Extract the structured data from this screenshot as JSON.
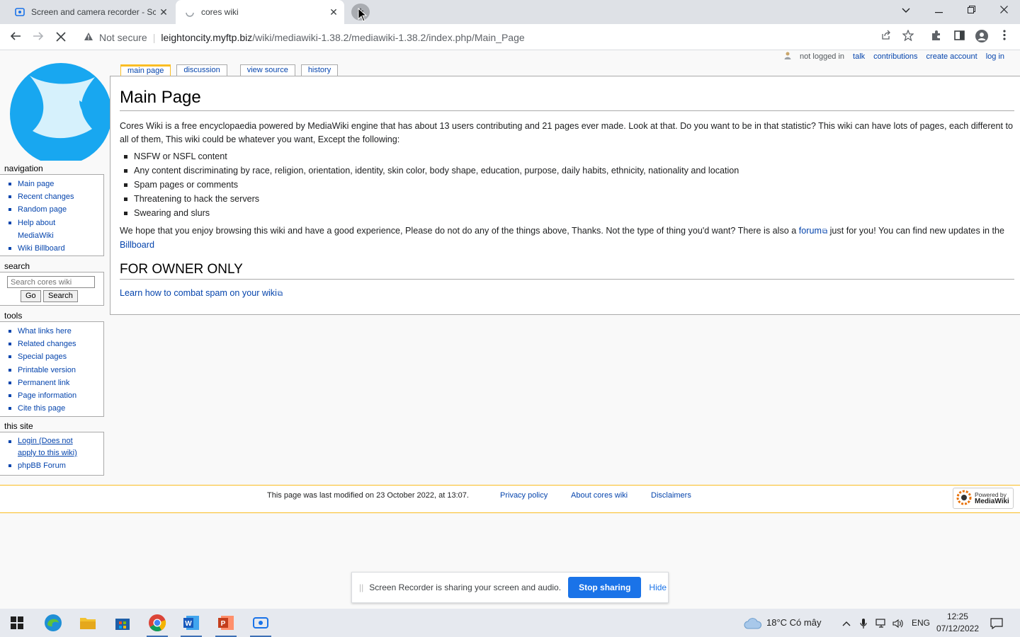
{
  "browser": {
    "tabs": [
      {
        "title": "Screen and camera recorder - Sc",
        "close": "✕"
      },
      {
        "title": "cores wiki",
        "close": "✕"
      }
    ],
    "new_tab": "+",
    "address": {
      "security_label": "Not secure",
      "host": "leightoncity.myftp.biz",
      "path": "/wiki/mediawiki-1.38.2/mediawiki-1.38.2/index.php/Main_Page"
    }
  },
  "personal": {
    "not_logged_in": "not logged in",
    "talk": "talk",
    "contributions": "contributions",
    "create_account": "create account",
    "log_in": "log in"
  },
  "page_tabs": [
    "main page",
    "discussion",
    "view source",
    "history"
  ],
  "content": {
    "title": "Main Page",
    "intro": "Cores Wiki is a free encyclopaedia powered by MediaWiki engine that has about 13 users contributing and 21 pages ever made. Look at that. Do you want to be in that statistic? This wiki can have lots of pages, each different to all of them, This wiki could be whatever you want, Except the following:",
    "rules": [
      "NSFW or NSFL content",
      "Any content discriminating by race, religion, orientation, identity, skin color, body shape, education, purpose, daily habits, ethnicity, nationality and location",
      "Spam pages or comments",
      "Threatening to hack the servers",
      "Swearing and slurs"
    ],
    "outro_before": "We hope that you enjoy browsing this wiki and have a good experience, Please do not do any of the things above, Thanks. Not the type of thing you'd want? There is also a",
    "forum_link": "forum",
    "outro_middle": "just for you! You can find new updates in the",
    "billboard_link": "Billboard",
    "section_title": "FOR OWNER ONLY",
    "spam_link": "Learn how to combat spam on your wiki"
  },
  "sidebar": {
    "navigation": {
      "heading": "navigation",
      "items": [
        "Main page",
        "Recent changes",
        "Random page",
        "Help about MediaWiki",
        "Wiki Billboard"
      ]
    },
    "search": {
      "heading": "search",
      "placeholder": "Search cores wiki",
      "go": "Go",
      "search": "Search"
    },
    "tools": {
      "heading": "tools",
      "items": [
        "What links here",
        "Related changes",
        "Special pages",
        "Printable version",
        "Permanent link",
        "Page information",
        "Cite this page"
      ]
    },
    "this_site": {
      "heading": "this site",
      "items": [
        "Login (Does not apply to this wiki)",
        "phpBB Forum"
      ]
    }
  },
  "footer": {
    "modified": "This page was last modified on 23 October 2022, at 13:07.",
    "privacy": "Privacy policy",
    "about": "About cores wiki",
    "disclaimers": "Disclaimers",
    "powered_top": "Powered by",
    "powered_bottom": "MediaWiki"
  },
  "share_bar": {
    "message": "Screen Recorder is sharing your screen and audio.",
    "stop": "Stop sharing",
    "hide": "Hide"
  },
  "taskbar": {
    "weather": "18°C  Có mây",
    "lang": "ENG",
    "time": "12:25",
    "date": "07/12/2022"
  },
  "colors": {
    "link": "#0645ad",
    "accent_tab": "#fabd23",
    "share_button": "#1a73e8"
  }
}
